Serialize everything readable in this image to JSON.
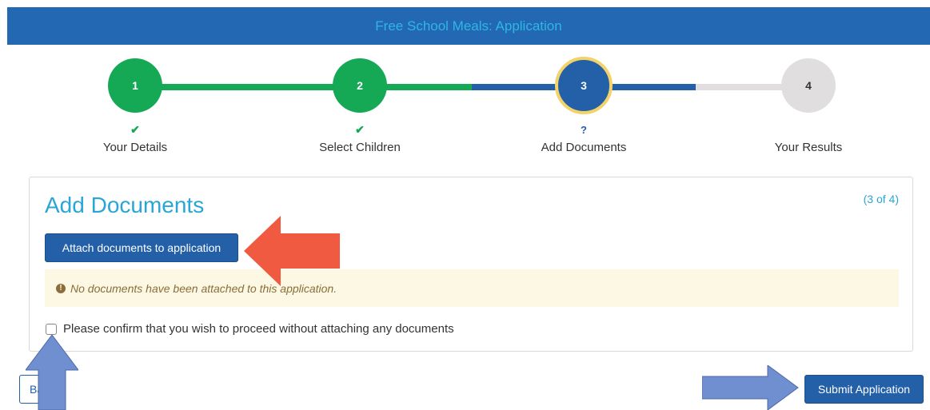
{
  "header": {
    "title": "Free School Meals: Application"
  },
  "steps": [
    {
      "number": "1",
      "label": "Your Details",
      "status_mark": "✔",
      "state": "done"
    },
    {
      "number": "2",
      "label": "Select Children",
      "status_mark": "✔",
      "state": "done"
    },
    {
      "number": "3",
      "label": "Add Documents",
      "status_mark": "?",
      "state": "active"
    },
    {
      "number": "4",
      "label": "Your Results",
      "status_mark": "",
      "state": "todo"
    }
  ],
  "panel": {
    "title": "Add Documents",
    "step_count": "(3 of 4)",
    "attach_button": "Attach documents to application",
    "notice_icon": "!",
    "notice": "No documents have been attached to this application.",
    "confirm_label": "Please confirm that you wish to proceed without attaching any documents",
    "confirm_checked": false
  },
  "footer": {
    "back_button": "Back",
    "submit_button": "Submit Application"
  },
  "colors": {
    "header_bg": "#2268b3",
    "primary": "#2360a8",
    "done": "#15a855",
    "active_ring": "#f3d26a",
    "accent_text": "#2aa6d6",
    "annotation_red_arrow": "#f05a40",
    "annotation_blue_arrow": "#6f8fd0"
  }
}
